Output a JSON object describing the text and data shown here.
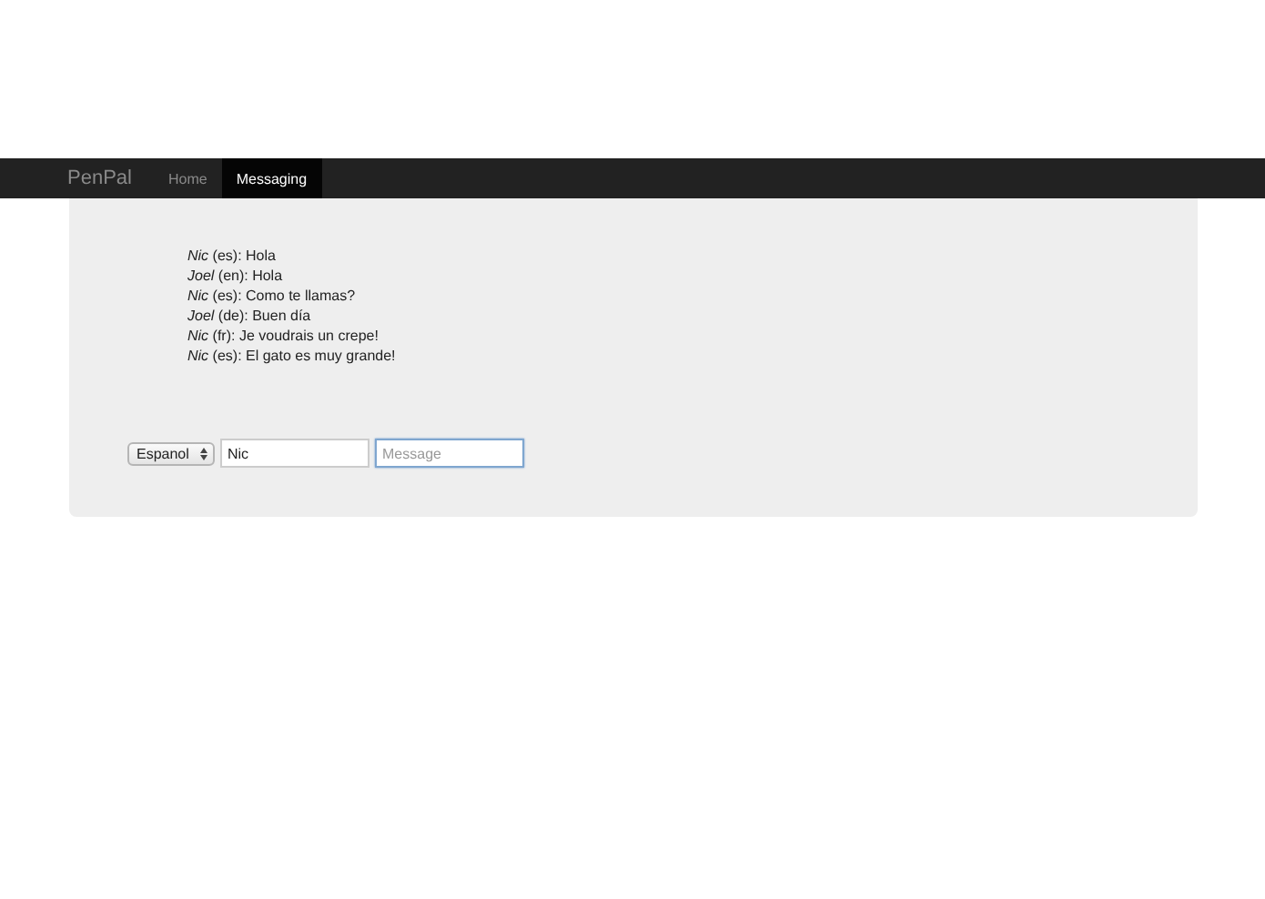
{
  "navbar": {
    "brand": "PenPal",
    "links": [
      {
        "label": "Home",
        "selected": false
      },
      {
        "label": "Messaging",
        "selected": true
      }
    ]
  },
  "messages": [
    {
      "text": "*Nic* (es): Hola"
    },
    {
      "text": "*Joel* (en): Hola"
    },
    {
      "text": "*Nic* (es): Como te llamas?"
    },
    {
      "text": "*Joel* (de): Buen día"
    },
    {
      "text": "*Nic* (fr): Je voudrais un crepe!"
    },
    {
      "text": "*Nic* (es): El gato es muy grande!"
    }
  ],
  "form": {
    "language": "Espanol",
    "name": "Nic",
    "message": {
      "placeholder": "Message",
      "focused": true
    }
  }
}
